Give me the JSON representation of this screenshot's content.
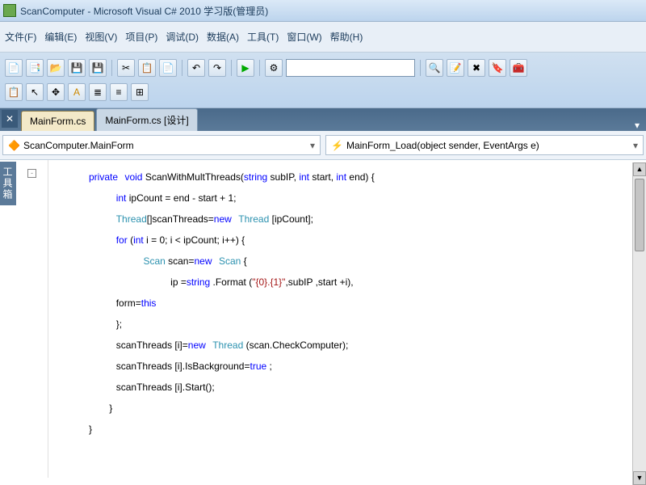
{
  "window": {
    "title": "ScanComputer - Microsoft Visual C# 2010 学习版(管理员)"
  },
  "menu": {
    "file": "文件(F)",
    "edit": "编辑(E)",
    "view": "视图(V)",
    "project": "项目(P)",
    "debug": "调试(D)",
    "data": "数据(A)",
    "tools": "工具(T)",
    "window": "窗口(W)",
    "help": "帮助(H)"
  },
  "tabs": {
    "active": "MainForm.cs",
    "inactive": "MainForm.cs [设计]"
  },
  "sidebar": {
    "toolbox": "工具箱"
  },
  "nav": {
    "class": "ScanComputer.MainForm",
    "member": "MainForm_Load(object sender, EventArgs e)"
  },
  "code": {
    "l1a": "private",
    "l1b": "void",
    "l1c": " ScanWithMultThreads(",
    "l1d": "string",
    "l1e": " subIP, ",
    "l1f": "int",
    "l1g": " start, ",
    "l1h": "int",
    "l1i": " end) {",
    "l2a": "int",
    "l2b": " ipCount = end - start + 1;",
    "l3a": "Thread",
    "l3b": "[]scanThreads=",
    "l3c": "new",
    "l3d": "Thread",
    "l3e": " [ipCount];",
    "l4a": "for",
    "l4b": " (",
    "l4c": "int",
    "l4d": " i = 0; i < ipCount; i++) {",
    "l5a": "Scan",
    "l5b": " scan=",
    "l5c": "new",
    "l5d": "Scan",
    "l5e": " {",
    "l6a": "ip =",
    "l6b": "string",
    "l6c": " .Format (",
    "l6d": "\"{0}.{1}\"",
    "l6e": ",subIP ,start +i),",
    "l7a": "form=",
    "l7b": "this",
    "l8": "};",
    "l9a": "scanThreads [i]=",
    "l9b": "new",
    "l9c": "Thread",
    "l9d": " (scan.CheckComputer);",
    "l10a": "scanThreads [i].IsBackground=",
    "l10b": "true",
    "l10c": " ;",
    "l11": "scanThreads [i].Start();",
    "l12": "}",
    "l13": "}"
  }
}
